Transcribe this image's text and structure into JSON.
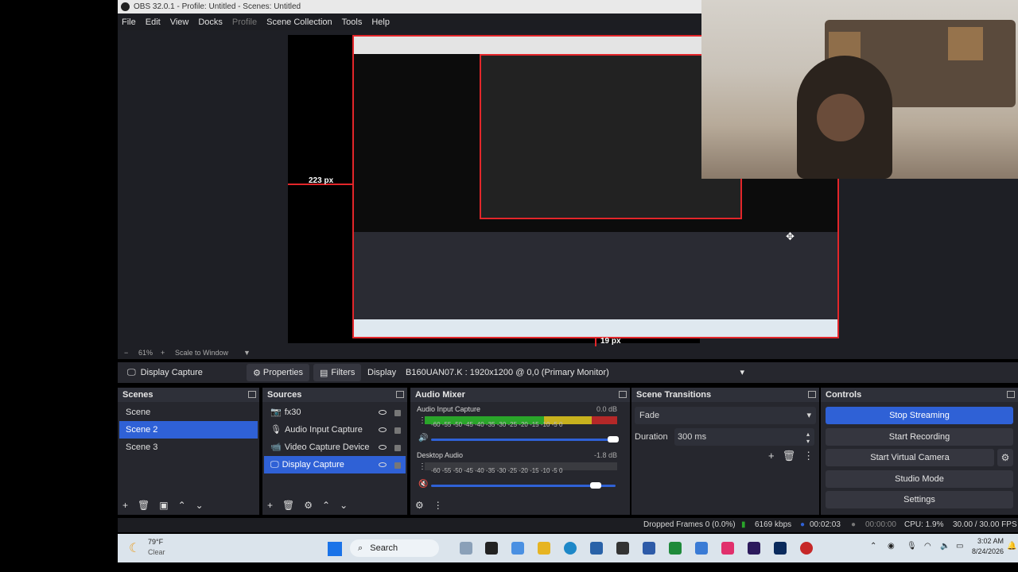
{
  "window": {
    "title": "OBS 32.0.1 - Profile: Untitled - Scenes: Untitled"
  },
  "menu": [
    "File",
    "Edit",
    "View",
    "Docks",
    "Profile",
    "Scene Collection",
    "Tools",
    "Help"
  ],
  "preview": {
    "measure_left": "223 px",
    "measure_bottom": "19 px",
    "zoom": "61%",
    "scale_mode": "Scale to Window"
  },
  "source_toolbar": {
    "source_name": "Display Capture",
    "properties": "Properties",
    "filters": "Filters",
    "display_label": "Display",
    "display_value": "B160UAN07.K : 1920x1200 @ 0,0 (Primary Monitor)"
  },
  "scenes": {
    "title": "Scenes",
    "items": [
      "Scene",
      "Scene 2",
      "Scene 3"
    ],
    "selected": "Scene 2"
  },
  "sources": {
    "title": "Sources",
    "items": [
      "fx30",
      "Audio Input Capture",
      "Video Capture Device",
      "Display Capture"
    ],
    "selected": "Display Capture"
  },
  "audio_mixer": {
    "title": "Audio Mixer",
    "channels": [
      {
        "name": "Audio Input Capture",
        "db": "0.0 dB"
      },
      {
        "name": "Desktop Audio",
        "db": "-1.8 dB"
      }
    ],
    "ticks": "-60 -55 -50 -45 -40 -35 -30 -25 -20 -15 -10 -5 0"
  },
  "scene_transitions": {
    "title": "Scene Transitions",
    "transition": "Fade",
    "duration_label": "Duration",
    "duration_value": "300 ms"
  },
  "controls": {
    "title": "Controls",
    "buttons": [
      "Stop Streaming",
      "Start Recording",
      "Start Virtual Camera",
      "Studio Mode",
      "Settings"
    ],
    "active": "Stop Streaming"
  },
  "status": {
    "dropped_frames": "Dropped Frames 0 (0.0%)",
    "bitrate": "6169 kbps",
    "stream_time": "00:02:03",
    "rec_time": "00:00:00",
    "cpu": "CPU: 1.9%",
    "fps": "30.00 / 30.00 FPS"
  },
  "taskbar": {
    "weather_temp": "79°F",
    "weather_cond": "Clear",
    "search": "Search",
    "time": "3:02 AM",
    "date": "8/24/2026"
  },
  "colors": {
    "accent": "#2f61d6",
    "red_outline": "#e3262a",
    "panel": "#26272e"
  }
}
